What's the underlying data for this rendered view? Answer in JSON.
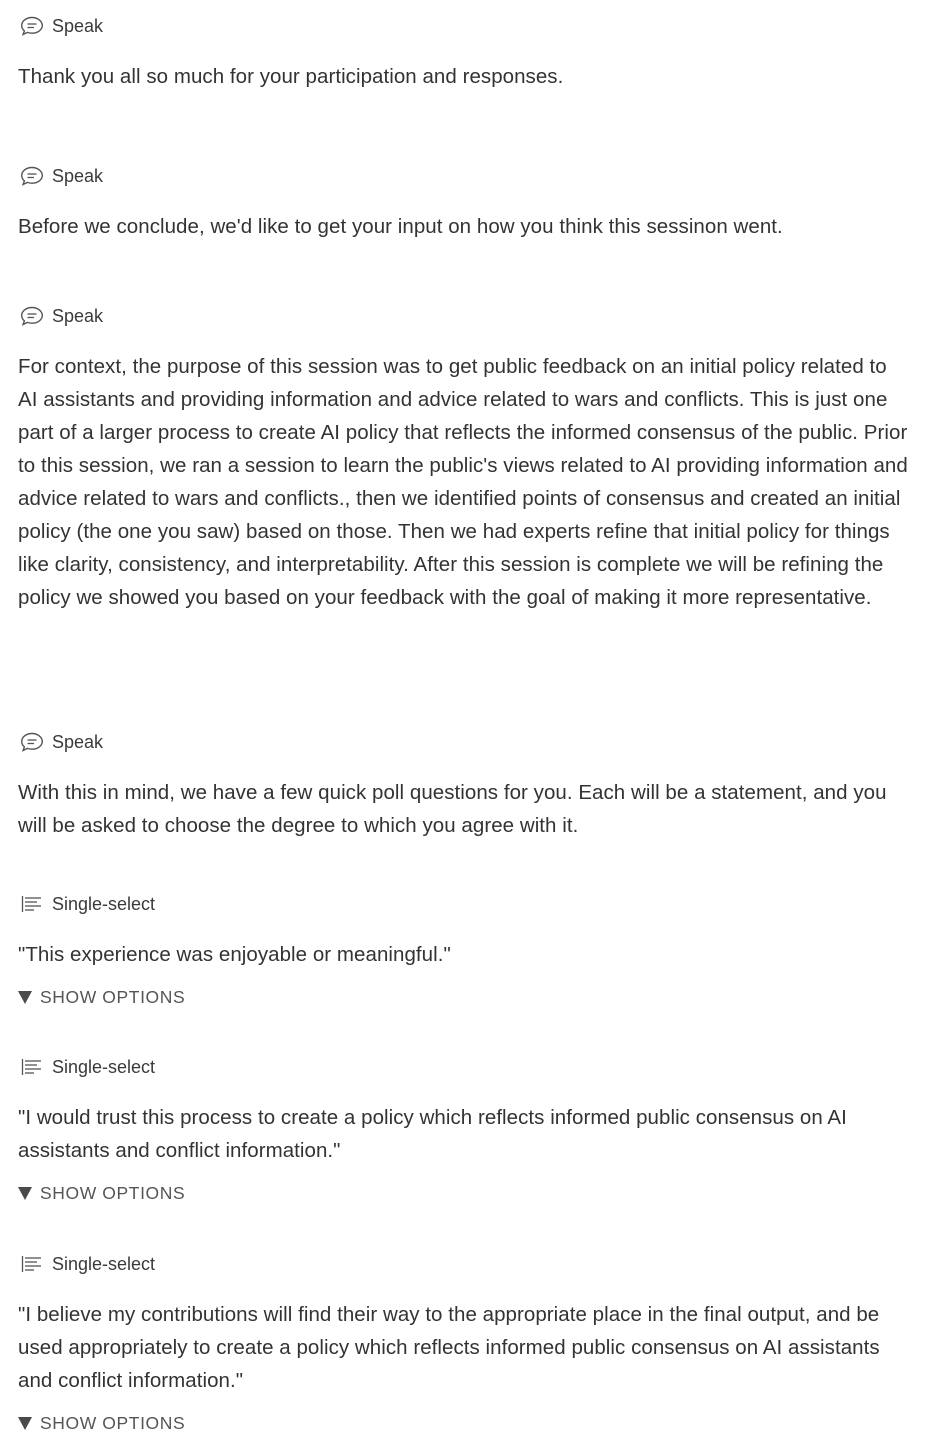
{
  "blocks": [
    {
      "type_label": "Speak",
      "icon": "chat-bubble-icon",
      "text": "Thank you all so much for your participation and responses."
    },
    {
      "type_label": "Speak",
      "icon": "chat-bubble-icon",
      "text": "Before we conclude, we'd like to get your input on how you think this sessinon went."
    },
    {
      "type_label": "Speak",
      "icon": "chat-bubble-icon",
      "text": "For context, the purpose of this session was to get public feedback on an initial policy related to AI assistants and providing information and advice related to wars and conflicts. This is just one part of a larger process to create AI policy that reflects the informed consensus of the public. Prior to this session, we ran a session to learn the public's views related to AI providing information and advice related to wars and conflicts., then we identified points of consensus and created an initial policy (the one you saw) based on those. Then we had experts refine that initial policy for things like clarity, consistency, and interpretability. After this session is complete we will be refining the policy we showed you based on your feedback with the goal of making it more representative."
    },
    {
      "type_label": "Speak",
      "icon": "chat-bubble-icon",
      "text": "With this in mind, we have a few quick poll questions for you. Each will be a statement, and you will be asked to choose the degree to which you agree with it."
    },
    {
      "type_label": "Single-select",
      "icon": "list-lines-icon",
      "text": "\"This experience was enjoyable or meaningful.\"",
      "toggle": "SHOW OPTIONS"
    },
    {
      "type_label": "Single-select",
      "icon": "list-lines-icon",
      "text": "\"I would trust this process to create a policy which reflects informed public consensus on AI assistants and conflict information.\"",
      "toggle": "SHOW OPTIONS"
    },
    {
      "type_label": "Single-select",
      "icon": "list-lines-icon",
      "text": "\"I believe my contributions will find their way to the appropriate place in the final output, and be used appropriately to create a policy which reflects informed public consensus on AI assistants and conflict information.\"",
      "toggle": "SHOW OPTIONS"
    }
  ]
}
